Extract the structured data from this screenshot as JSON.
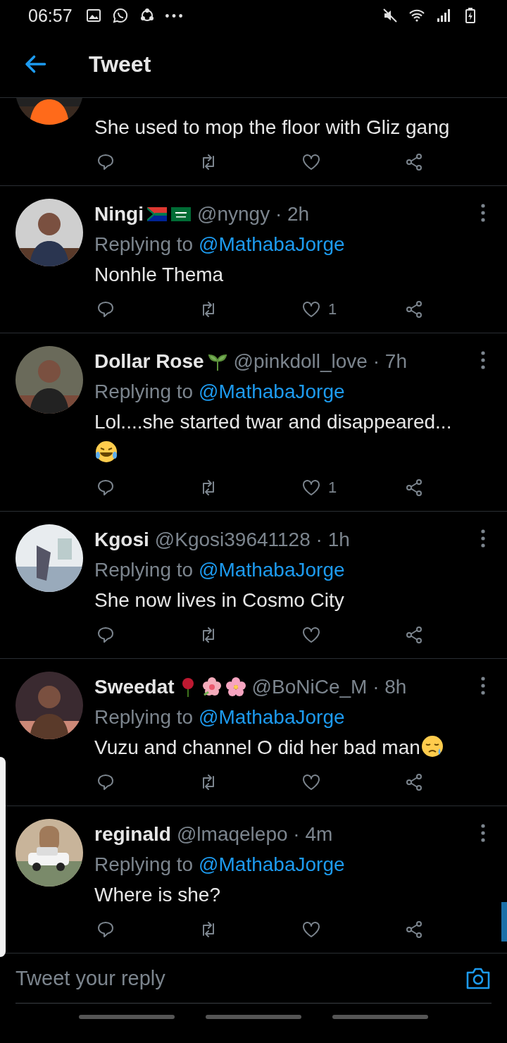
{
  "status_bar": {
    "time": "06:57"
  },
  "header": {
    "title": "Tweet"
  },
  "tweets": [
    {
      "partial": true,
      "text": "She used to mop the floor with Gliz gang"
    },
    {
      "partial": false,
      "name": "Ningi",
      "badges": [
        {
          "kind": "flag-za"
        },
        {
          "kind": "flag-sa"
        }
      ],
      "meta": "@nyngy · 2h",
      "replying_label": "Replying to",
      "reply_handle": "@MathabaJorge",
      "text": "Nonhle Thema",
      "likes": "1"
    },
    {
      "partial": false,
      "name": "Dollar Rose",
      "badges": [
        {
          "kind": "sprout"
        }
      ],
      "meta": "@pinkdoll_love · 7h",
      "replying_label": "Replying to",
      "reply_handle": "@MathabaJorge",
      "text": "Lol....she started twar and disappeared...",
      "emoji": {
        "kind": "laughing"
      },
      "likes": "1"
    },
    {
      "partial": false,
      "name": "Kgosi",
      "meta": "@Kgosi39641128 · 1h",
      "replying_label": "Replying to",
      "reply_handle": "@MathabaJorge",
      "text": "She now lives in Cosmo City"
    },
    {
      "partial": false,
      "name": "Sweedat",
      "badges": [
        {
          "kind": "rose"
        },
        {
          "kind": "hibiscus"
        },
        {
          "kind": "blossom"
        }
      ],
      "meta": "@BoNiCe_M · 8h",
      "replying_label": "Replying to",
      "reply_handle": "@MathabaJorge",
      "text": "Vuzu and channel O did her bad man",
      "emoji": {
        "kind": "sad"
      }
    },
    {
      "partial": false,
      "name": "reginald",
      "meta": "@lmaqelepo · 4m",
      "replying_label": "Replying to",
      "reply_handle": "@MathabaJorge",
      "text": "Where is she?"
    }
  ],
  "reply_bar": {
    "placeholder": "Tweet your reply"
  }
}
